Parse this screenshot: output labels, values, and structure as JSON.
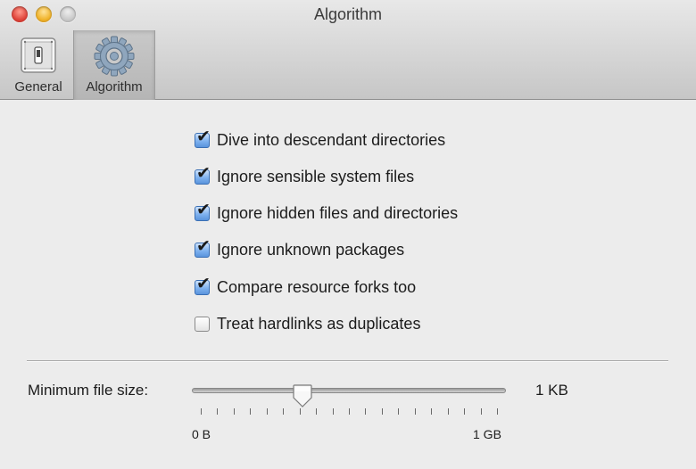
{
  "window": {
    "title": "Algorithm"
  },
  "toolbar": {
    "items": [
      {
        "label": "General",
        "icon": "toggle-switch-icon",
        "selected": false
      },
      {
        "label": "Algorithm",
        "icon": "gear-icon",
        "selected": true
      }
    ]
  },
  "options": [
    {
      "label": "Dive into descendant directories",
      "checked": true
    },
    {
      "label": "Ignore sensible system files",
      "checked": true
    },
    {
      "label": "Ignore hidden files and directories",
      "checked": true
    },
    {
      "label": "Ignore unknown packages",
      "checked": true
    },
    {
      "label": "Compare resource forks too",
      "checked": true
    },
    {
      "label": "Treat hardlinks as duplicates",
      "checked": false
    }
  ],
  "min_file_size": {
    "label": "Minimum file size:",
    "value_text": "1 KB",
    "slider_position": 0.35,
    "tick_count": 19,
    "min_label": "0 B",
    "max_label": "1 GB"
  },
  "colors": {
    "checkbox_accent": "#5a94dc",
    "window_background": "#ececec"
  }
}
